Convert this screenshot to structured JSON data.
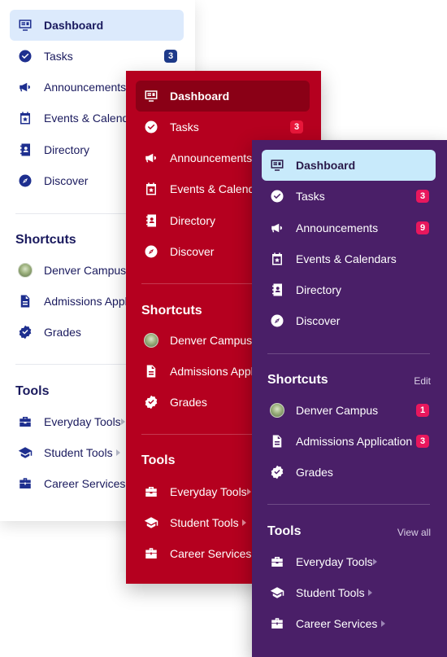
{
  "panels": {
    "white": {
      "nav": [
        {
          "label": "Dashboard",
          "icon": "dashboard-icon"
        },
        {
          "label": "Tasks",
          "icon": "check-circle-icon",
          "badge": "3"
        },
        {
          "label": "Announcements",
          "icon": "megaphone-icon"
        },
        {
          "label": "Events & Calendars",
          "icon": "calendar-icon"
        },
        {
          "label": "Directory",
          "icon": "contact-book-icon"
        },
        {
          "label": "Discover",
          "icon": "compass-icon"
        }
      ],
      "shortcuts_title": "Shortcuts",
      "shortcuts": [
        {
          "label": "Denver Campus",
          "icon": "campus-avatar-icon"
        },
        {
          "label": "Admissions Application",
          "icon": "document-icon"
        },
        {
          "label": "Grades",
          "icon": "verified-badge-icon"
        }
      ],
      "tools_title": "Tools",
      "tools": [
        {
          "label": "Everyday Tools",
          "icon": "toolbox-icon"
        },
        {
          "label": "Student Tools",
          "icon": "graduation-cap-icon"
        },
        {
          "label": "Career Services",
          "icon": "briefcase-icon"
        }
      ]
    },
    "red": {
      "nav": [
        {
          "label": "Dashboard",
          "icon": "dashboard-icon"
        },
        {
          "label": "Tasks",
          "icon": "check-circle-icon",
          "badge": "3"
        },
        {
          "label": "Announcements",
          "icon": "megaphone-icon"
        },
        {
          "label": "Events & Calendars",
          "icon": "calendar-icon"
        },
        {
          "label": "Directory",
          "icon": "contact-book-icon"
        },
        {
          "label": "Discover",
          "icon": "compass-icon"
        }
      ],
      "shortcuts_title": "Shortcuts",
      "shortcuts": [
        {
          "label": "Denver Campus",
          "icon": "campus-avatar-icon"
        },
        {
          "label": "Admissions Application",
          "icon": "document-icon"
        },
        {
          "label": "Grades",
          "icon": "verified-badge-icon"
        }
      ],
      "tools_title": "Tools",
      "tools": [
        {
          "label": "Everyday Tools",
          "icon": "toolbox-icon"
        },
        {
          "label": "Student Tools",
          "icon": "graduation-cap-icon"
        },
        {
          "label": "Career Services",
          "icon": "briefcase-icon"
        }
      ]
    },
    "purple": {
      "nav": [
        {
          "label": "Dashboard",
          "icon": "dashboard-icon"
        },
        {
          "label": "Tasks",
          "icon": "check-circle-icon",
          "badge": "3"
        },
        {
          "label": "Announcements",
          "icon": "megaphone-icon",
          "badge": "9"
        },
        {
          "label": "Events & Calendars",
          "icon": "calendar-icon"
        },
        {
          "label": "Directory",
          "icon": "contact-book-icon"
        },
        {
          "label": "Discover",
          "icon": "compass-icon"
        }
      ],
      "shortcuts_title": "Shortcuts",
      "shortcuts_action": "Edit",
      "shortcuts": [
        {
          "label": "Denver Campus",
          "icon": "campus-avatar-icon",
          "badge": "1"
        },
        {
          "label": "Admissions Application",
          "icon": "document-icon",
          "badge": "3"
        },
        {
          "label": "Grades",
          "icon": "verified-badge-icon"
        }
      ],
      "tools_title": "Tools",
      "tools_action": "View all",
      "tools": [
        {
          "label": "Everyday Tools",
          "icon": "toolbox-icon"
        },
        {
          "label": "Student Tools",
          "icon": "graduation-cap-icon"
        },
        {
          "label": "Career Services",
          "icon": "briefcase-icon"
        }
      ]
    }
  },
  "theme_colors": {
    "white_accent": "#1e2f8f",
    "red_background": "#b5001f",
    "purple_background": "#4a1f68",
    "purple_active": "#c8eafb",
    "badge_pink": "#e8175d"
  }
}
